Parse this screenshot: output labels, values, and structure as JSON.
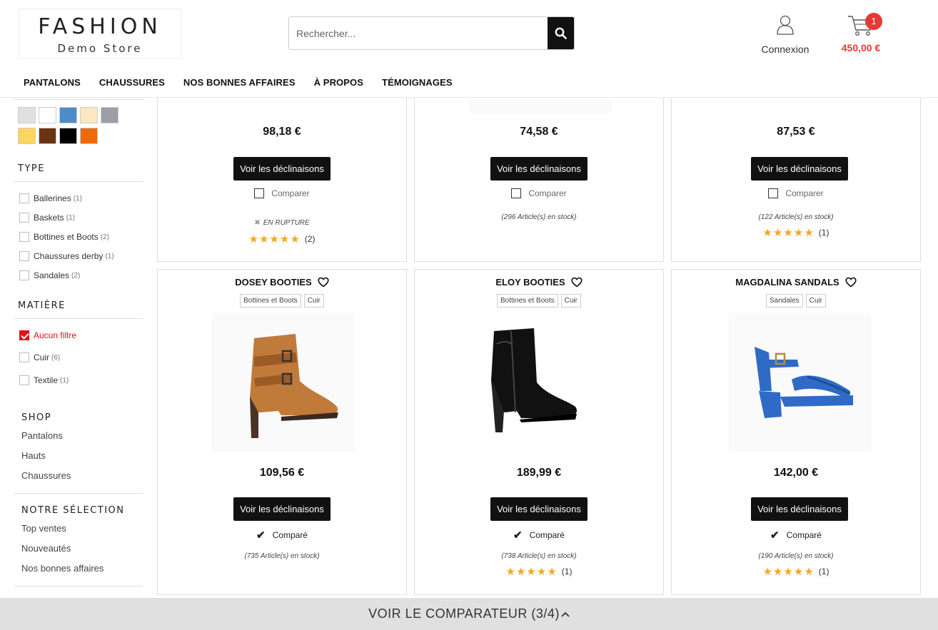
{
  "header": {
    "logo_main": "FASHION",
    "logo_sub": "Demo Store",
    "search_placeholder": "Rechercher...",
    "account_label": "Connexion",
    "cart_count": "1",
    "cart_total": "450,00 €"
  },
  "nav": [
    "PANTALONS",
    "CHAUSSURES",
    "NOS BONNES AFFAIRES",
    "À PROPOS",
    "TÉMOIGNAGES"
  ],
  "sidebar": {
    "swatches": [
      "#e0e0e0",
      "#ffffff",
      "#4f8bc9",
      "#fde6c2",
      "#9e9ea6",
      "#fdd55f",
      "#6b3410",
      "#000000",
      "#ec6a0b"
    ],
    "type_title": "TYPE",
    "types": [
      {
        "label": "Ballerines",
        "count": "(1)"
      },
      {
        "label": "Baskets",
        "count": "(1)"
      },
      {
        "label": "Bottines et Boots",
        "count": "(2)"
      },
      {
        "label": "Chaussures derby",
        "count": "(1)"
      },
      {
        "label": "Sandales",
        "count": "(2)"
      }
    ],
    "matiere_title": "MATIÈRE",
    "matieres": [
      {
        "label": "Aucun filtre",
        "count": ""
      },
      {
        "label": "Cuir",
        "count": "(6)"
      },
      {
        "label": "Textile",
        "count": "(1)"
      }
    ],
    "shop_title": "SHOP",
    "shop_links": [
      "Pantalons",
      "Hauts",
      "Chaussures"
    ],
    "selection_title": "NOTRE SÉLECTION",
    "selection_links": [
      "Top ventes",
      "Nouveautés",
      "Nos bonnes affaires"
    ]
  },
  "products_top": [
    {
      "price": "98,18 €",
      "button": "Voir les déclinaisons",
      "compare": "Comparer",
      "rupture": "EN RUPTURE",
      "reviews": "(2)"
    },
    {
      "price": "74,58 €",
      "button": "Voir les déclinaisons",
      "compare": "Comparer",
      "stock": "(296 Article(s) en stock)"
    },
    {
      "price": "87,53 €",
      "button": "Voir les déclinaisons",
      "compare": "Comparer",
      "stock": "(122 Article(s) en stock)",
      "reviews": "(1)"
    }
  ],
  "products_bottom": [
    {
      "name": "DOSEY BOOTIES",
      "tags": [
        "Bottines et Boots",
        "Cuir"
      ],
      "price": "109,56 €",
      "button": "Voir les déclinaisons",
      "compare": "Comparé",
      "stock": "(735 Article(s) en stock)"
    },
    {
      "name": "ELOY BOOTIES",
      "tags": [
        "Bottines et Boots",
        "Cuir"
      ],
      "price": "189,99 €",
      "button": "Voir les déclinaisons",
      "compare": "Comparé",
      "stock": "(738 Article(s) en stock)",
      "reviews": "(1)"
    },
    {
      "name": "MAGDALINA SANDALS",
      "tags": [
        "Sandales",
        "Cuir"
      ],
      "price": "142,00 €",
      "button": "Voir les déclinaisons",
      "compare": "Comparé",
      "stock": "(190 Article(s) en stock)",
      "reviews": "(1)"
    }
  ],
  "stars": "★★★★★",
  "compare_bar": "VOIR LE COMPARATEUR (3/4)",
  "icons": {
    "search": "search-icon",
    "account": "user-icon",
    "cart": "cart-icon",
    "heart": "heart-icon",
    "chevron": "chevron-up-icon"
  },
  "colors": {
    "accent_red": "#e53935",
    "filter_red": "#e10f1a",
    "star": "#f5a623",
    "button": "#111111"
  }
}
